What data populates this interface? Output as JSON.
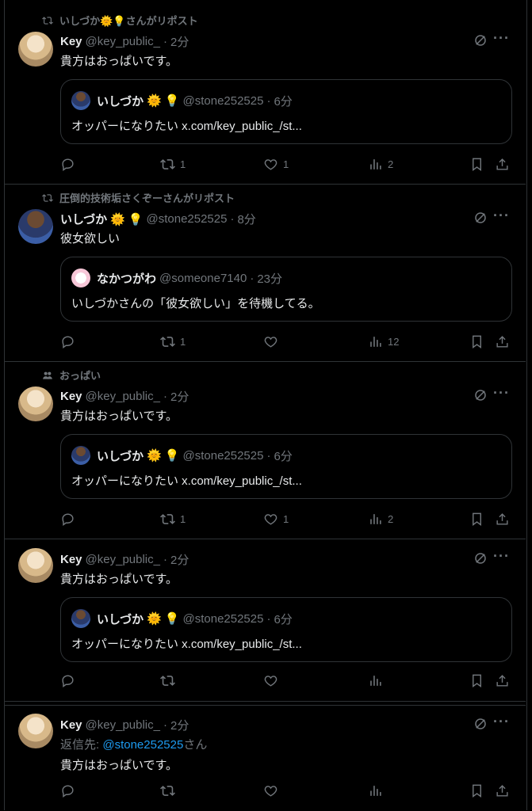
{
  "posts": [
    {
      "context": "いしづか🌞💡さんがリポスト",
      "name": "Key",
      "handle": "@key_public_",
      "time": "2分",
      "text": "貴方はおっぱいです。",
      "quote": {
        "name": "いしづか",
        "handle": "@stone252525",
        "time": "6分",
        "text": "オッパーになりたい x.com/key_public_/st..."
      },
      "actions": {
        "retweets": "1",
        "likes": "1",
        "views": "2"
      }
    },
    {
      "context": "圧倒的技術垢さくぞーさんがリポスト",
      "name": "いしづか",
      "handle": "@stone252525",
      "time": "8分",
      "text": "彼女欲しい",
      "quote": {
        "name": "なかつがわ",
        "handle": "@someone7140",
        "time": "23分",
        "text": "いしづかさんの「彼女欲しい」を待機してる。"
      },
      "actions": {
        "retweets": "1",
        "likes": "",
        "views": "12"
      }
    },
    {
      "context": "おっぱい",
      "name": "Key",
      "handle": "@key_public_",
      "time": "2分",
      "text": "貴方はおっぱいです。",
      "quote": {
        "name": "いしづか",
        "handle": "@stone252525",
        "time": "6分",
        "text": "オッパーになりたい x.com/key_public_/st..."
      },
      "actions": {
        "retweets": "1",
        "likes": "1",
        "views": "2"
      }
    },
    {
      "name": "Key",
      "handle": "@key_public_",
      "time": "2分",
      "text": "貴方はおっぱいです。",
      "quote": {
        "name": "いしづか",
        "handle": "@stone252525",
        "time": "6分",
        "text": "オッパーになりたい x.com/key_public_/st..."
      },
      "actions": {
        "retweets": "",
        "likes": "",
        "views": ""
      }
    },
    {
      "name": "Key",
      "handle": "@key_public_",
      "time": "2分",
      "reply_prefix": "返信先: ",
      "reply_handle": "@stone252525",
      "reply_suffix": "さん",
      "text": "貴方はおっぱいです。",
      "actions": {
        "retweets": "",
        "likes": "",
        "views": ""
      }
    }
  ],
  "icons": [
    "retweet-icon",
    "people-icon",
    "grok-icon",
    "more-icon",
    "reply-icon",
    "like-icon",
    "views-icon",
    "bookmark-icon",
    "share-icon"
  ],
  "colors": {
    "background": "#000000",
    "text": "#e7e9ea",
    "muted": "#71767b",
    "border": "#2f3336",
    "link": "#1d9bf0"
  }
}
